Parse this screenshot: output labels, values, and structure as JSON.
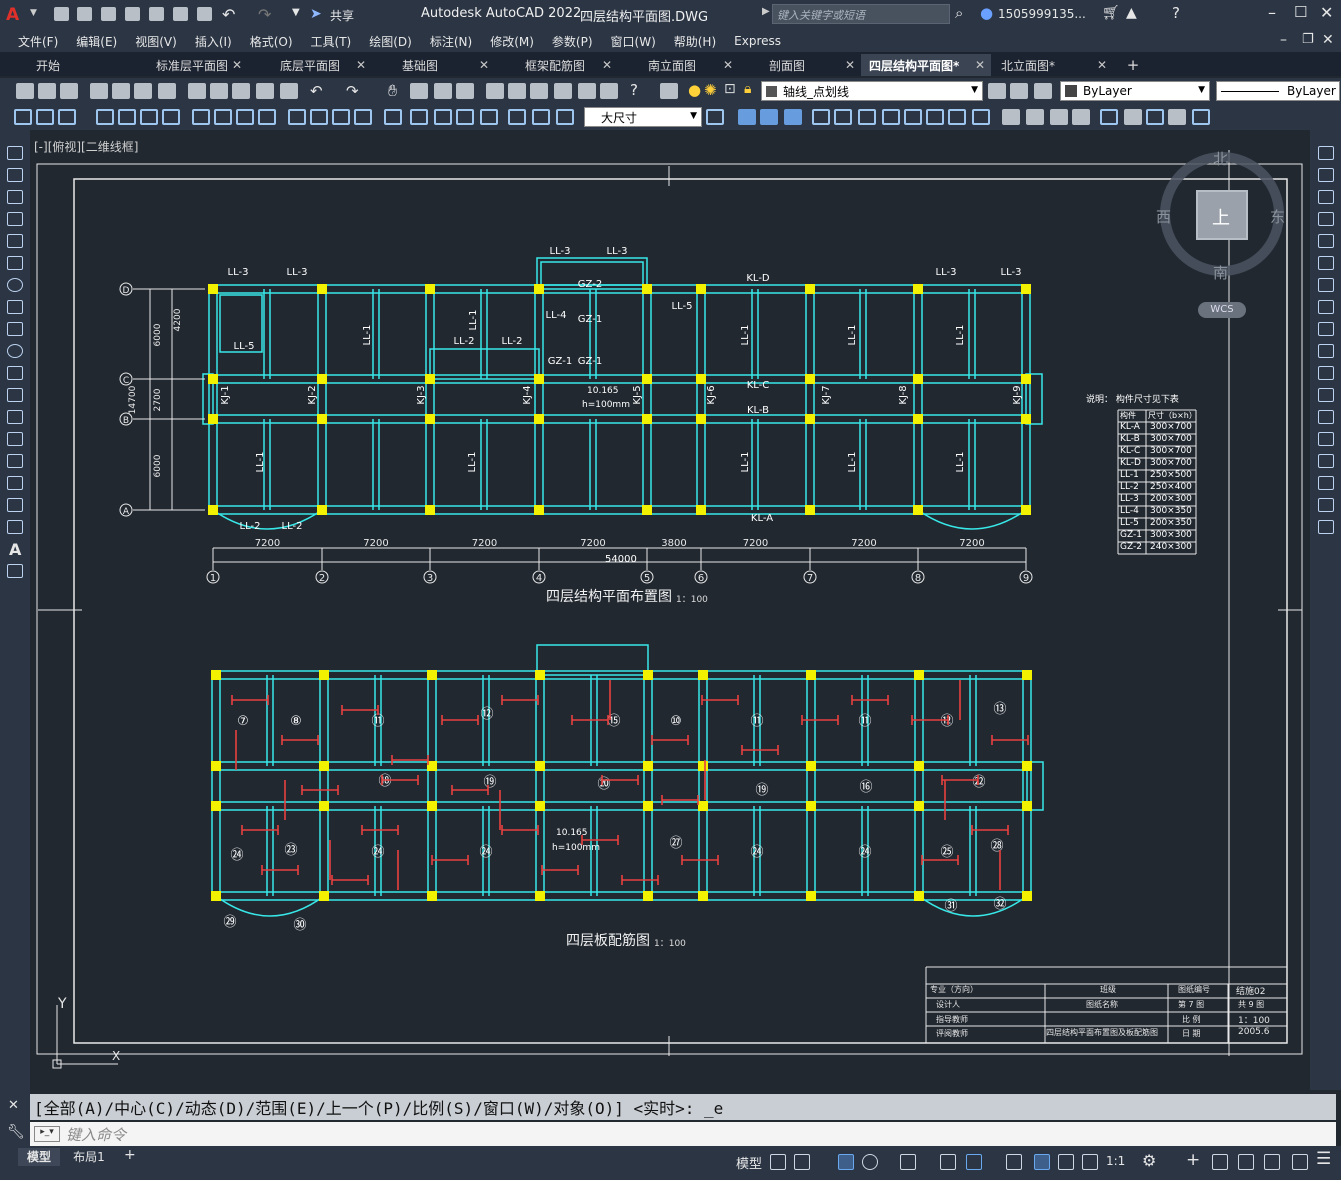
{
  "app": {
    "title": "Autodesk AutoCAD 2022",
    "document": "四层结构平面图.DWG",
    "search_placeholder": "键入关键字或短语",
    "user": "1505999135...",
    "share": "共享"
  },
  "menu": [
    "文件(F)",
    "编辑(E)",
    "视图(V)",
    "插入(I)",
    "格式(O)",
    "工具(T)",
    "绘图(D)",
    "标注(N)",
    "修改(M)",
    "参数(P)",
    "窗口(W)",
    "帮助(H)",
    "Express"
  ],
  "tabs": [
    {
      "label": "开始",
      "active": false
    },
    {
      "label": "标准层平面图",
      "active": false
    },
    {
      "label": "底层平面图",
      "active": false
    },
    {
      "label": "基础图",
      "active": false
    },
    {
      "label": "框架配筋图",
      "active": false
    },
    {
      "label": "南立面图",
      "active": false
    },
    {
      "label": "剖面图",
      "active": false
    },
    {
      "label": "四层结构平面图*",
      "active": true
    },
    {
      "label": "北立面图*",
      "active": false
    }
  ],
  "toolbar": {
    "layer_name": "轴线_点划线",
    "color_value": "ByLayer",
    "linetype_value": "ByLayer",
    "dimstyle_value": "大尺寸"
  },
  "viewport": {
    "label": "[-][俯视][二维线框]"
  },
  "viewcube": {
    "north": "北",
    "south": "南",
    "east": "东",
    "west": "西",
    "top": "上",
    "wcs": "WCS"
  },
  "drawing": {
    "plan_title": "四层结构平面布置图",
    "plan_scale": "1：100",
    "slab_title": "四层板配筋图",
    "slab_scale": "1：100",
    "axes_x": [
      "1",
      "2",
      "3",
      "4",
      "5",
      "6",
      "7",
      "8",
      "9"
    ],
    "axes_y": [
      "D",
      "C",
      "B",
      "A"
    ],
    "spans": [
      "7200",
      "7200",
      "7200",
      "7200",
      "3800",
      "7200",
      "7200",
      "7200"
    ],
    "total_length": "54000",
    "beam_labels": [
      "LL-3",
      "LL-3",
      "LL-3",
      "LL-3",
      "LL-3",
      "LL-3",
      "KL-D",
      "KL-C",
      "KL-B",
      "KL-A",
      "LL-5",
      "LL-5",
      "LL-2",
      "LL-2",
      "LL-2",
      "LL-2",
      "LL-4",
      "GZ-2",
      "GZ-1",
      "GZ-1",
      "GZ-1",
      "KJ-1",
      "KJ-2",
      "KJ-3",
      "KJ-4",
      "KJ-5",
      "KJ-6",
      "KJ-7",
      "KJ-8",
      "KJ-9",
      "LL-1"
    ],
    "elevation": "10.165",
    "slab_h": "h=100mm",
    "vert_dims": [
      "4200",
      "6000",
      "2700",
      "6000",
      "14700"
    ],
    "note_title": "说明：  构件尺寸见下表",
    "member_table": {
      "headers": [
        "构件",
        "尺寸（b×h）"
      ],
      "rows": [
        [
          "KL-A",
          "300×700"
        ],
        [
          "KL-B",
          "300×700"
        ],
        [
          "KL-C",
          "300×700"
        ],
        [
          "KL-D",
          "300×700"
        ],
        [
          "LL-1",
          "250×500"
        ],
        [
          "LL-2",
          "250×400"
        ],
        [
          "LL-3",
          "200×300"
        ],
        [
          "LL-4",
          "300×350"
        ],
        [
          "LL-5",
          "200×350"
        ],
        [
          "GZ-1",
          "300×300"
        ],
        [
          "GZ-2",
          "240×300"
        ]
      ]
    },
    "title_block": {
      "c1": [
        "专业（方向）",
        "设计人",
        "指导教师",
        "评阅教师"
      ],
      "c2": [
        "班级",
        "图纸名称"
      ],
      "c3": [
        "图纸编号",
        "第 7 图",
        "比 例",
        "日 期"
      ],
      "c4": [
        "结施02",
        "共 9 图",
        "1：100",
        "2005.6"
      ],
      "drawing_name": "四层结构平面布置图及板配筋图"
    }
  },
  "command": {
    "history": "[全部(A)/中心(C)/动态(D)/范围(E)/上一个(P)/比例(S)/窗口(W)/对象(O)] <实时>: _e",
    "placeholder": "键入命令"
  },
  "status": {
    "tab_model": "模型",
    "tab_layout": "布局1",
    "model_btn": "模型",
    "scale": "1:1"
  }
}
